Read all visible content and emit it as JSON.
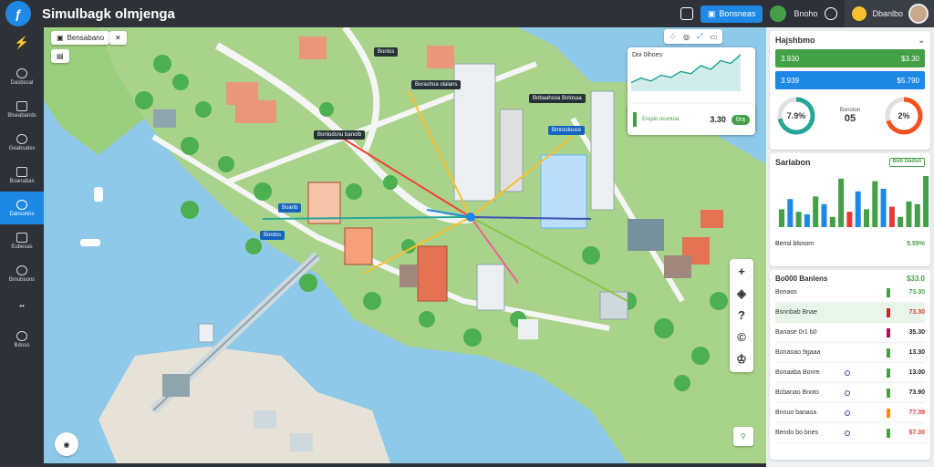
{
  "app": {
    "title": "Simulbagk olmjenga"
  },
  "topbar": {
    "primary_button": "Bonsneas",
    "status_label": "Bnoho",
    "user_label": "Dbanlbo"
  },
  "sidebar": {
    "items": [
      {
        "label": "",
        "icon": "brand-icon"
      },
      {
        "label": "Dasbscal",
        "icon": "dashboard-icon"
      },
      {
        "label": "Blseabands",
        "icon": "compass-icon"
      },
      {
        "label": "Geabsatss",
        "icon": "clipboard-icon"
      },
      {
        "label": "Boanabas",
        "icon": "monitor-icon"
      },
      {
        "label": "Dansonns",
        "icon": "leaf-icon"
      },
      {
        "label": "Eubesas",
        "icon": "chart-icon"
      },
      {
        "label": "Bmubsons",
        "icon": "flask-icon"
      },
      {
        "label": "",
        "icon": "more-icon"
      },
      {
        "label": "Bdoso",
        "icon": "clock-icon"
      }
    ],
    "active_index": 5
  },
  "map": {
    "toolbar_label": "Bensabano",
    "labels": [
      {
        "text": "Bonlos"
      },
      {
        "text": "Borashoa olalans"
      },
      {
        "text": "Bobaahsoa Bolosaa"
      },
      {
        "text": "Bonlodsnu  banolb"
      },
      {
        "text": "Bmroolouce"
      },
      {
        "text": "Boanb"
      },
      {
        "text": "Bordos"
      }
    ],
    "chart_card": {
      "title": "Doi 0ihoes",
      "values": [
        12,
        18,
        14,
        22,
        19,
        27,
        24,
        35,
        30,
        42,
        38,
        50
      ]
    },
    "mini_stat": {
      "label": "Eroplo ocuntoa",
      "value": "3.30",
      "badge": "0ra"
    },
    "zoom": {
      "plus": "+",
      "help": "?",
      "info": "©"
    }
  },
  "panel": {
    "summary": {
      "title": "Hajshbmo",
      "rows": [
        {
          "left": "3.930",
          "right": "$3.30",
          "color": "#43a047"
        },
        {
          "left": "3.939",
          "right": "$5.790",
          "color": "#1e88e5"
        }
      ],
      "donut_left": "7.9%",
      "donut_left_value": 0.72,
      "mid_label": "Bonoton",
      "mid_value": "05",
      "donut_right": "2%",
      "donut_right_value": 0.7
    },
    "stats": {
      "title": "Sarlabon",
      "badge": "Bsb Dadsn",
      "footer_label": "Bensl blsnom",
      "footer_value": "5.55%",
      "bars": [
        {
          "v": 0.35,
          "c": "#43a047"
        },
        {
          "v": 0.55,
          "c": "#1e88e5"
        },
        {
          "v": 0.3,
          "c": "#43a047"
        },
        {
          "v": 0.25,
          "c": "#1e88e5"
        },
        {
          "v": 0.6,
          "c": "#43a047"
        },
        {
          "v": 0.45,
          "c": "#1e88e5"
        },
        {
          "v": 0.2,
          "c": "#43a047"
        },
        {
          "v": 0.95,
          "c": "#43a047"
        },
        {
          "v": 0.3,
          "c": "#e53935"
        },
        {
          "v": 0.7,
          "c": "#1e88e5"
        },
        {
          "v": 0.35,
          "c": "#43a047"
        },
        {
          "v": 0.9,
          "c": "#43a047"
        },
        {
          "v": 0.75,
          "c": "#1e88e5"
        },
        {
          "v": 0.4,
          "c": "#e53935"
        },
        {
          "v": 0.2,
          "c": "#43a047"
        },
        {
          "v": 0.5,
          "c": "#43a047"
        },
        {
          "v": 0.45,
          "c": "#43a047"
        },
        {
          "v": 1.0,
          "c": "#43a047"
        }
      ]
    },
    "list": {
      "title": "Bo000 Banlens",
      "title_value": "$33.0",
      "rows": [
        {
          "name": "Bonaos",
          "flag": "#43a047",
          "value": "73.30",
          "vcolor": "#43a047",
          "dot": false
        },
        {
          "name": "Bsnnbab Bnae",
          "flag": "#c62828",
          "value": "73.30",
          "vcolor": "#e53935",
          "dot": false
        },
        {
          "name": "Banase 0r1 b0",
          "flag": "#ad1457",
          "value": "35.30",
          "vcolor": "#222",
          "dot": false
        },
        {
          "name": "Bonaoao 9gaaa",
          "flag": "#43a047",
          "value": "13.30",
          "vcolor": "#222",
          "dot": false
        },
        {
          "name": "Bonaaba Bonre",
          "flag": "#43a047",
          "value": "13.00",
          "vcolor": "#222",
          "dot": true
        },
        {
          "name": "Bcbanao Bnoto",
          "flag": "#43a047",
          "value": "73.90",
          "vcolor": "#222",
          "dot": true
        },
        {
          "name": "Bnnuo banasa",
          "flag": "#fb8c00",
          "value": "77.39",
          "vcolor": "#e53935",
          "dot": true
        },
        {
          "name": "Bendo bo bnes",
          "flag": "#43a047",
          "value": "$7.30",
          "vcolor": "#e53935",
          "dot": true
        }
      ]
    }
  }
}
